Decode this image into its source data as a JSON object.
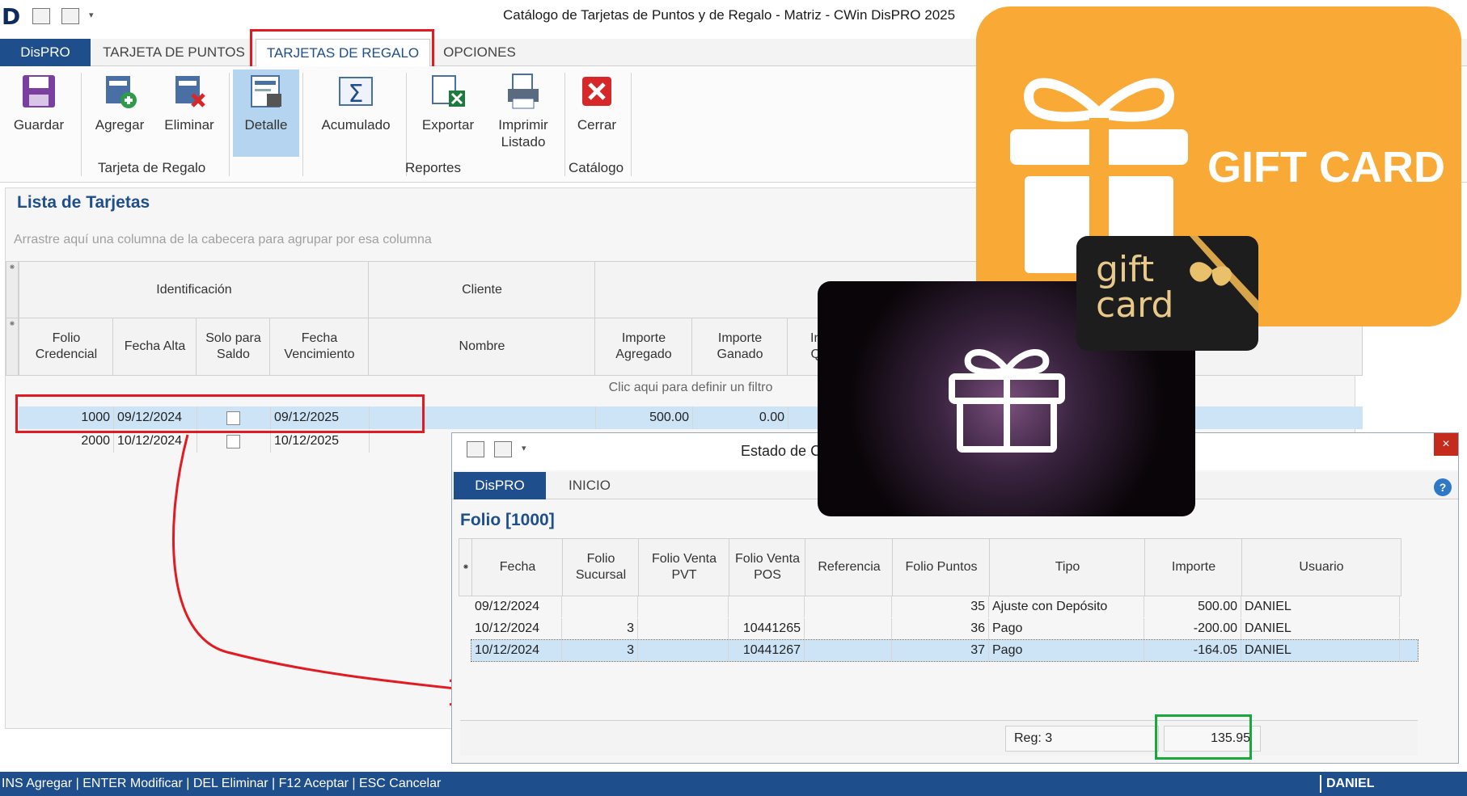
{
  "window": {
    "logo": "D",
    "title": "Catálogo de Tarjetas de Puntos y de Regalo - Matriz - CWin DisPRO 2025"
  },
  "ribbon_tabs": {
    "dispro": "DisPRO",
    "puntos": "TARJETA DE PUNTOS",
    "regalo": "TARJETAS DE REGALO",
    "opciones": "OPCIONES"
  },
  "ribbon": {
    "guardar": "Guardar",
    "agregar": "Agregar",
    "eliminar": "Eliminar",
    "detalle": "Detalle",
    "acumulado": "Acumulado",
    "exportar": "Exportar",
    "imprimir_1": "Imprimir",
    "imprimir_2": "Listado",
    "cerrar": "Cerrar",
    "group_tarjeta": "Tarjeta de Regalo",
    "group_reportes": "Reportes",
    "group_catalogo": "Catálogo"
  },
  "list": {
    "title": "Lista de Tarjetas",
    "group_hint": "Arrastre aquí una columna de la cabecera para agrupar por esa columna",
    "band_identificacion": "Identificación",
    "band_cliente": "Cliente",
    "col_folio_1": "Folio",
    "col_folio_2": "Credencial",
    "col_fecha_alta": "Fecha Alta",
    "col_solo_1": "Solo para",
    "col_solo_2": "Saldo",
    "col_venc_1": "Fecha",
    "col_venc_2": "Vencimiento",
    "col_nombre": "Nombre",
    "col_imp_agr_1": "Importe",
    "col_imp_agr_2": "Agregado",
    "col_imp_gan_1": "Importe",
    "col_imp_gan_2": "Ganado",
    "col_partial_1": "In",
    "col_partial_2": "Q",
    "filter_hint": "Clic aqui para definir un filtro",
    "rows": [
      {
        "folio": "1000",
        "fecha_alta": "09/12/2024",
        "vencimiento": "09/12/2025",
        "agregado": "500.00",
        "ganado": "0.00"
      },
      {
        "folio": "2000",
        "fecha_alta": "10/12/2024",
        "vencimiento": "10/12/2025",
        "agregado": "",
        "ganado": ""
      }
    ]
  },
  "dialog": {
    "title": "Estado de C",
    "close": "×",
    "tab_dispro": "DisPRO",
    "tab_inicio": "INICIO",
    "help": "?",
    "folio": "Folio [1000]",
    "col_fecha": "Fecha",
    "col_suc_1": "Folio",
    "col_suc_2": "Sucursal",
    "col_pvt_1": "Folio Venta",
    "col_pvt_2": "PVT",
    "col_pos_1": "Folio Venta",
    "col_pos_2": "POS",
    "col_ref": "Referencia",
    "col_puntos": "Folio Puntos",
    "col_tipo": "Tipo",
    "col_importe": "Importe",
    "col_usuario": "Usuario",
    "rows": [
      {
        "fecha": "09/12/2024",
        "sucursal": "",
        "pvt": "",
        "pos": "",
        "ref": "",
        "puntos": "35",
        "tipo": "Ajuste con Depósito",
        "importe": "500.00",
        "usuario": "DANIEL"
      },
      {
        "fecha": "10/12/2024",
        "sucursal": "3",
        "pvt": "",
        "pos": "10441265",
        "ref": "",
        "puntos": "36",
        "tipo": "Pago",
        "importe": "-200.00",
        "usuario": "DANIEL"
      },
      {
        "fecha": "10/12/2024",
        "sucursal": "3",
        "pvt": "",
        "pos": "10441267",
        "ref": "",
        "puntos": "37",
        "tipo": "Pago",
        "importe": "-164.05",
        "usuario": "DANIEL"
      }
    ],
    "reg": "Reg: 3",
    "total": "135.95"
  },
  "statusbar": {
    "shortcuts": "INS Agregar | ENTER Modificar | DEL Eliminar | F12 Aceptar | ESC Cancelar",
    "user": "DANIEL"
  },
  "overlays": {
    "gift_card_orange": "GIFT CARD",
    "gift_card_black_1": "gift",
    "gift_card_black_2": "card"
  },
  "colors": {
    "accent_blue": "#1f4e8c",
    "highlight_red": "#e21b23",
    "highlight_green": "#1aa83a",
    "selected_row": "#cde4f7",
    "gift_orange": "#f9a935"
  }
}
